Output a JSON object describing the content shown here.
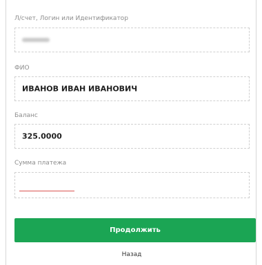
{
  "form": {
    "account": {
      "label": "Л/счет, Логин или Идентификатор",
      "value_masked": true
    },
    "fio": {
      "label": "ФИО",
      "value": "ИВАНОВ ИВАН ИВАНОВИЧ"
    },
    "balance": {
      "label": "Баланс",
      "value": "325.0000"
    },
    "amount": {
      "label": "Сумма платежа",
      "value": "",
      "placeholder": ""
    }
  },
  "actions": {
    "continue_label": "Продолжить",
    "back_label": "Назад"
  },
  "colors": {
    "primary": "#1ba554",
    "error_underline": "#d9534f"
  }
}
